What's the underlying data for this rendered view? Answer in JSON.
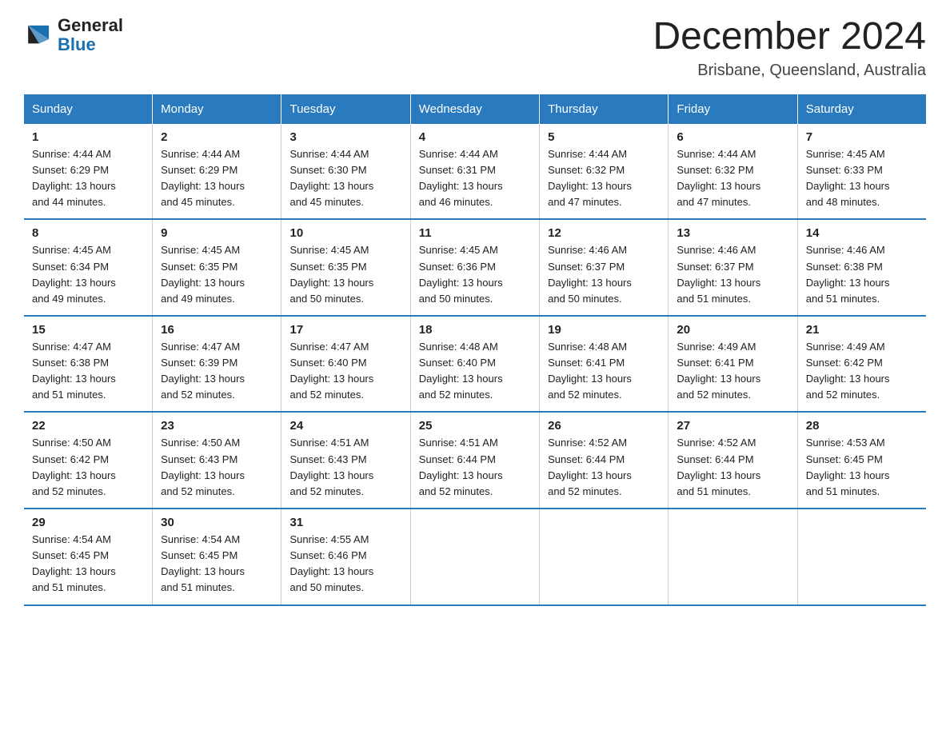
{
  "logo": {
    "text_general": "General",
    "text_blue": "Blue",
    "icon_label": "general-blue-logo"
  },
  "header": {
    "title": "December 2024",
    "subtitle": "Brisbane, Queensland, Australia"
  },
  "weekdays": [
    "Sunday",
    "Monday",
    "Tuesday",
    "Wednesday",
    "Thursday",
    "Friday",
    "Saturday"
  ],
  "weeks": [
    [
      {
        "num": "1",
        "sunrise": "4:44 AM",
        "sunset": "6:29 PM",
        "daylight": "13 hours and 44 minutes."
      },
      {
        "num": "2",
        "sunrise": "4:44 AM",
        "sunset": "6:29 PM",
        "daylight": "13 hours and 45 minutes."
      },
      {
        "num": "3",
        "sunrise": "4:44 AM",
        "sunset": "6:30 PM",
        "daylight": "13 hours and 45 minutes."
      },
      {
        "num": "4",
        "sunrise": "4:44 AM",
        "sunset": "6:31 PM",
        "daylight": "13 hours and 46 minutes."
      },
      {
        "num": "5",
        "sunrise": "4:44 AM",
        "sunset": "6:32 PM",
        "daylight": "13 hours and 47 minutes."
      },
      {
        "num": "6",
        "sunrise": "4:44 AM",
        "sunset": "6:32 PM",
        "daylight": "13 hours and 47 minutes."
      },
      {
        "num": "7",
        "sunrise": "4:45 AM",
        "sunset": "6:33 PM",
        "daylight": "13 hours and 48 minutes."
      }
    ],
    [
      {
        "num": "8",
        "sunrise": "4:45 AM",
        "sunset": "6:34 PM",
        "daylight": "13 hours and 49 minutes."
      },
      {
        "num": "9",
        "sunrise": "4:45 AM",
        "sunset": "6:35 PM",
        "daylight": "13 hours and 49 minutes."
      },
      {
        "num": "10",
        "sunrise": "4:45 AM",
        "sunset": "6:35 PM",
        "daylight": "13 hours and 50 minutes."
      },
      {
        "num": "11",
        "sunrise": "4:45 AM",
        "sunset": "6:36 PM",
        "daylight": "13 hours and 50 minutes."
      },
      {
        "num": "12",
        "sunrise": "4:46 AM",
        "sunset": "6:37 PM",
        "daylight": "13 hours and 50 minutes."
      },
      {
        "num": "13",
        "sunrise": "4:46 AM",
        "sunset": "6:37 PM",
        "daylight": "13 hours and 51 minutes."
      },
      {
        "num": "14",
        "sunrise": "4:46 AM",
        "sunset": "6:38 PM",
        "daylight": "13 hours and 51 minutes."
      }
    ],
    [
      {
        "num": "15",
        "sunrise": "4:47 AM",
        "sunset": "6:38 PM",
        "daylight": "13 hours and 51 minutes."
      },
      {
        "num": "16",
        "sunrise": "4:47 AM",
        "sunset": "6:39 PM",
        "daylight": "13 hours and 52 minutes."
      },
      {
        "num": "17",
        "sunrise": "4:47 AM",
        "sunset": "6:40 PM",
        "daylight": "13 hours and 52 minutes."
      },
      {
        "num": "18",
        "sunrise": "4:48 AM",
        "sunset": "6:40 PM",
        "daylight": "13 hours and 52 minutes."
      },
      {
        "num": "19",
        "sunrise": "4:48 AM",
        "sunset": "6:41 PM",
        "daylight": "13 hours and 52 minutes."
      },
      {
        "num": "20",
        "sunrise": "4:49 AM",
        "sunset": "6:41 PM",
        "daylight": "13 hours and 52 minutes."
      },
      {
        "num": "21",
        "sunrise": "4:49 AM",
        "sunset": "6:42 PM",
        "daylight": "13 hours and 52 minutes."
      }
    ],
    [
      {
        "num": "22",
        "sunrise": "4:50 AM",
        "sunset": "6:42 PM",
        "daylight": "13 hours and 52 minutes."
      },
      {
        "num": "23",
        "sunrise": "4:50 AM",
        "sunset": "6:43 PM",
        "daylight": "13 hours and 52 minutes."
      },
      {
        "num": "24",
        "sunrise": "4:51 AM",
        "sunset": "6:43 PM",
        "daylight": "13 hours and 52 minutes."
      },
      {
        "num": "25",
        "sunrise": "4:51 AM",
        "sunset": "6:44 PM",
        "daylight": "13 hours and 52 minutes."
      },
      {
        "num": "26",
        "sunrise": "4:52 AM",
        "sunset": "6:44 PM",
        "daylight": "13 hours and 52 minutes."
      },
      {
        "num": "27",
        "sunrise": "4:52 AM",
        "sunset": "6:44 PM",
        "daylight": "13 hours and 51 minutes."
      },
      {
        "num": "28",
        "sunrise": "4:53 AM",
        "sunset": "6:45 PM",
        "daylight": "13 hours and 51 minutes."
      }
    ],
    [
      {
        "num": "29",
        "sunrise": "4:54 AM",
        "sunset": "6:45 PM",
        "daylight": "13 hours and 51 minutes."
      },
      {
        "num": "30",
        "sunrise": "4:54 AM",
        "sunset": "6:45 PM",
        "daylight": "13 hours and 51 minutes."
      },
      {
        "num": "31",
        "sunrise": "4:55 AM",
        "sunset": "6:46 PM",
        "daylight": "13 hours and 50 minutes."
      },
      null,
      null,
      null,
      null
    ]
  ],
  "labels": {
    "sunrise": "Sunrise:",
    "sunset": "Sunset:",
    "daylight": "Daylight:"
  }
}
